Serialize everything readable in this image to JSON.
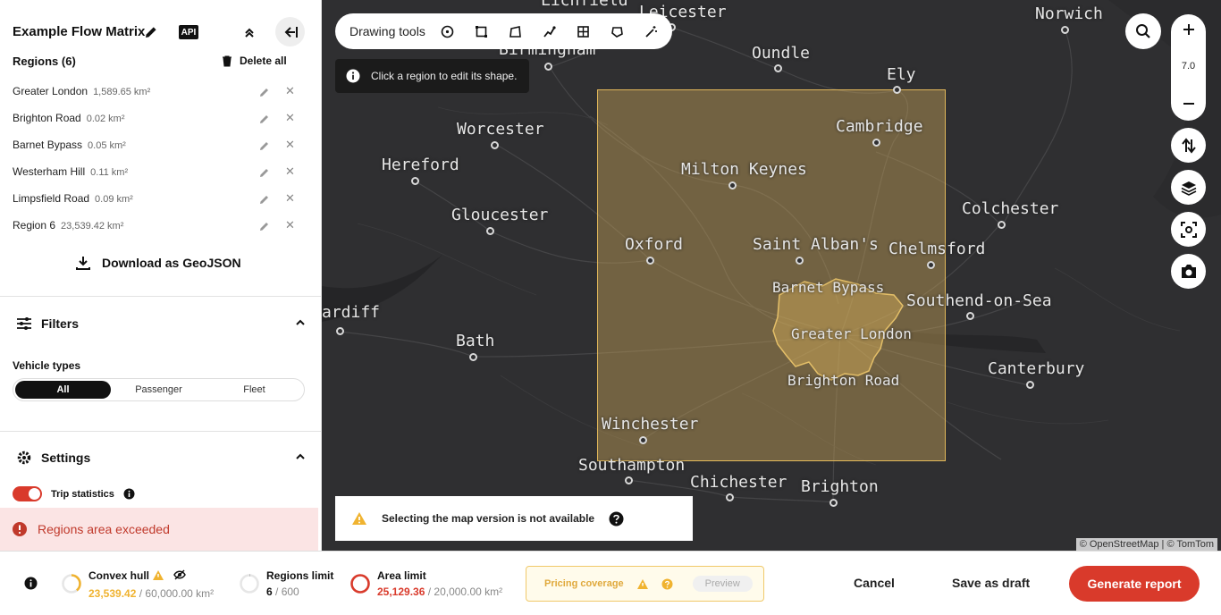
{
  "header": {
    "title": "Example Flow Matrix",
    "api_label": "API"
  },
  "regions": {
    "heading": "Regions (6)",
    "delete_all": "Delete all",
    "items": [
      {
        "name": "Greater London",
        "area": "1,589.65 km²"
      },
      {
        "name": "Brighton Road",
        "area": "0.02 km²"
      },
      {
        "name": "Barnet Bypass",
        "area": "0.05 km²"
      },
      {
        "name": "Westerham Hill",
        "area": "0.11 km²"
      },
      {
        "name": "Limpsfield Road",
        "area": "0.09 km²"
      },
      {
        "name": "Region 6",
        "area": "23,539.42 km²"
      }
    ],
    "download_label": "Download as GeoJSON"
  },
  "filters": {
    "heading": "Filters",
    "vehicle_types_label": "Vehicle types",
    "options": [
      "All",
      "Passenger",
      "Fleet"
    ],
    "selected": "All"
  },
  "settings": {
    "heading": "Settings",
    "trip_statistics_label": "Trip statistics",
    "trip_statistics_on": true
  },
  "alert": {
    "text": "Regions area exceeded"
  },
  "map": {
    "toolbar_label": "Drawing tools",
    "tooltip": "Click a region to edit its shape.",
    "zoom": "7.0",
    "notice": "Selecting the map version is not available",
    "attribution": "© OpenStreetMap | © TomTom",
    "cities": [
      {
        "name": "Lichfield"
      },
      {
        "name": "Leicester"
      },
      {
        "name": "Norwich"
      },
      {
        "name": "Birmingham"
      },
      {
        "name": "Oundle"
      },
      {
        "name": "Ely"
      },
      {
        "name": "Worcester"
      },
      {
        "name": "Cambridge"
      },
      {
        "name": "Hereford"
      },
      {
        "name": "Milton Keynes"
      },
      {
        "name": "Gloucester"
      },
      {
        "name": "Colchester"
      },
      {
        "name": "Oxford"
      },
      {
        "name": "Saint Alban's"
      },
      {
        "name": "Chelmsford"
      },
      {
        "name": "Barnet Bypass"
      },
      {
        "name": "Southend-on-Sea"
      },
      {
        "name": "ardiff"
      },
      {
        "name": "Greater London"
      },
      {
        "name": "Bath"
      },
      {
        "name": "Canterbury"
      },
      {
        "name": "Brighton Road"
      },
      {
        "name": "Winchester"
      },
      {
        "name": "Southampton"
      },
      {
        "name": "Chichester"
      },
      {
        "name": "Brighton"
      }
    ]
  },
  "bottom": {
    "convex_hull": {
      "label": "Convex hull",
      "value": "23,539.42",
      "limit": "/ 60,000.00 km²",
      "fill": 0.39
    },
    "regions_limit": {
      "label": "Regions limit",
      "value": "6",
      "limit": "/ 600",
      "fill": 0.01
    },
    "area_limit": {
      "label": "Area limit",
      "value": "25,129.36",
      "limit": "/ 20,000.00 km²",
      "fill": 1.0
    },
    "pricing_label": "Pricing coverage",
    "preview_label": "Preview",
    "cancel": "Cancel",
    "save_draft": "Save as draft",
    "generate": "Generate report"
  },
  "colors": {
    "accent": "#d93a2b",
    "warning": "#f0b330",
    "selection": "#d0aa5a",
    "map_bg": "#2f2f31"
  }
}
